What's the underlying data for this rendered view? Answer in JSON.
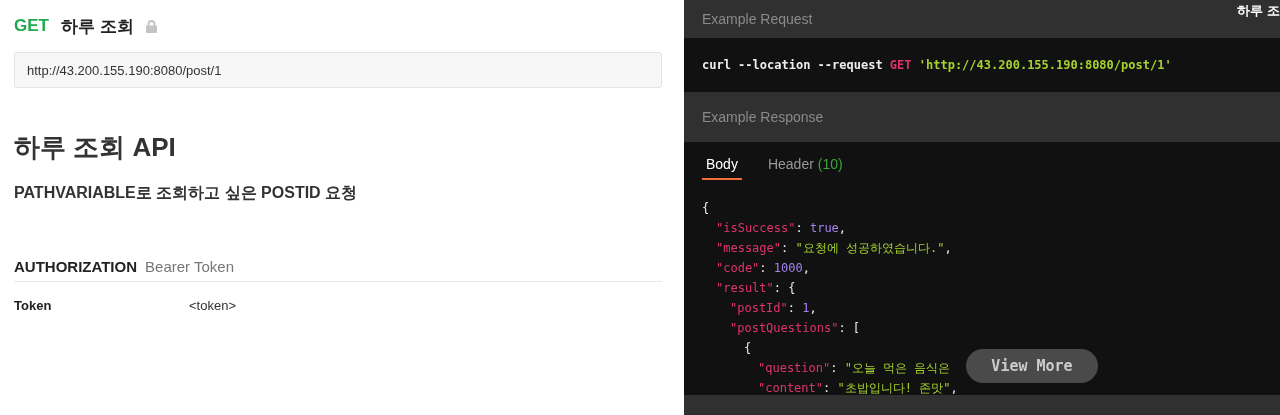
{
  "request": {
    "method": "GET",
    "name": "하루 조회",
    "locked": true,
    "url": "http://43.200.155.190:8080/post/1"
  },
  "doc": {
    "title": "하루 조회 API",
    "subtitle": "PATHVARIABLE로 조회하고 싶은 POSTID 요청"
  },
  "authorization": {
    "heading": "AUTHORIZATION",
    "type": "Bearer Token",
    "rows": [
      {
        "key": "Token",
        "value": "<token>"
      }
    ]
  },
  "example_request": {
    "label": "Example Request",
    "side_title": "하루 조",
    "command": [
      {
        "kind": "plain",
        "text": "curl --location --request "
      },
      {
        "kind": "method",
        "text": "GET"
      },
      {
        "kind": "string",
        "text": " 'http://43.200.155.190:8080/post/1'"
      }
    ]
  },
  "example_response": {
    "label": "Example Response",
    "tabs": [
      {
        "label": "Body",
        "selected": true
      },
      {
        "label": "Header",
        "count": "(10)",
        "selected": false
      }
    ],
    "lines": [
      {
        "tokens": [
          {
            "kind": "punct",
            "text": "{"
          }
        ],
        "children": [
          {
            "tokens": [
              {
                "kind": "key",
                "text": "\"isSuccess\""
              },
              {
                "kind": "punct",
                "text": ": "
              },
              {
                "kind": "literal",
                "text": "true"
              },
              {
                "kind": "punct",
                "text": ","
              }
            ]
          },
          {
            "tokens": [
              {
                "kind": "key",
                "text": "\"message\""
              },
              {
                "kind": "punct",
                "text": ": "
              },
              {
                "kind": "string",
                "text": "\"요청에 성공하였습니다.\""
              },
              {
                "kind": "punct",
                "text": ","
              }
            ]
          },
          {
            "tokens": [
              {
                "kind": "key",
                "text": "\"code\""
              },
              {
                "kind": "punct",
                "text": ": "
              },
              {
                "kind": "literal",
                "text": "1000"
              },
              {
                "kind": "punct",
                "text": ","
              }
            ]
          },
          {
            "tokens": [
              {
                "kind": "key",
                "text": "\"result\""
              },
              {
                "kind": "punct",
                "text": ": {"
              }
            ],
            "children": [
              {
                "tokens": [
                  {
                    "kind": "key",
                    "text": "\"postId\""
                  },
                  {
                    "kind": "punct",
                    "text": ": "
                  },
                  {
                    "kind": "literal",
                    "text": "1"
                  },
                  {
                    "kind": "punct",
                    "text": ","
                  }
                ]
              },
              {
                "tokens": [
                  {
                    "kind": "key",
                    "text": "\"postQuestions\""
                  },
                  {
                    "kind": "punct",
                    "text": ": ["
                  }
                ],
                "children": [
                  {
                    "tokens": [
                      {
                        "kind": "punct",
                        "text": "{"
                      }
                    ],
                    "children": [
                      {
                        "tokens": [
                          {
                            "kind": "key",
                            "text": "\"question\""
                          },
                          {
                            "kind": "punct",
                            "text": ": "
                          },
                          {
                            "kind": "string",
                            "text": "\"오늘 먹은 음식은"
                          }
                        ]
                      },
                      {
                        "tokens": [
                          {
                            "kind": "key",
                            "text": "\"content\""
                          },
                          {
                            "kind": "punct",
                            "text": ": "
                          },
                          {
                            "kind": "string",
                            "text": "\"초밥입니다! 존맛\""
                          },
                          {
                            "kind": "punct",
                            "text": ","
                          }
                        ]
                      }
                    ]
                  }
                ]
              }
            ]
          }
        ]
      }
    ],
    "more_button": "View More"
  }
}
